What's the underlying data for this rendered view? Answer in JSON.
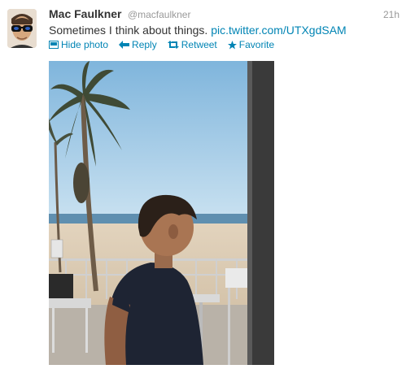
{
  "tweet": {
    "fullname": "Mac Faulkner",
    "username": "@macfaulkner",
    "timestamp": "21h",
    "text": "Sometimes I think about things.",
    "link_text": "pic.twitter.com/UTXgdSAM"
  },
  "actions": {
    "hide_photo": "Hide photo",
    "reply": "Reply",
    "retweet": "Retweet",
    "favorite": "Favorite"
  },
  "colors": {
    "link": "#0084b4",
    "muted": "#999999",
    "text": "#333333"
  },
  "icons": {
    "hide_photo": "photo-icon",
    "reply": "reply-arrow-icon",
    "retweet": "retweet-icon",
    "favorite": "star-icon"
  }
}
